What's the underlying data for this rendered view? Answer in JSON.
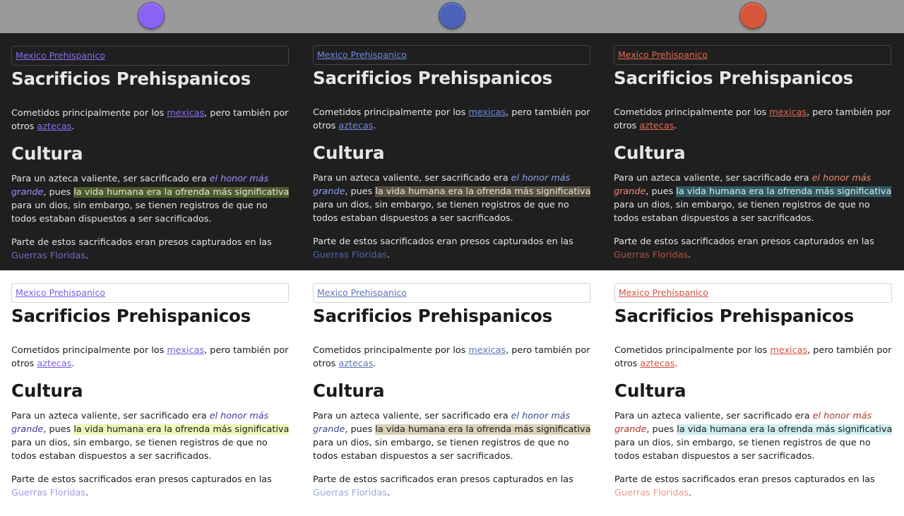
{
  "theme_buttons": [
    {
      "name": "purple-theme-button",
      "color": "#8a63f2"
    },
    {
      "name": "blue-theme-button",
      "color": "#4a63b8"
    },
    {
      "name": "red-theme-button",
      "color": "#d5553b"
    }
  ],
  "content": {
    "breadcrumb": "Mexico Prehispanico",
    "title": "Sacrificios Prehispanicos",
    "intro_before": "Cometidos principalmente por los ",
    "intro_link1": "mexicas",
    "intro_middle": ", pero también por otros ",
    "intro_link2": "aztecas",
    "intro_end": ".",
    "section_heading": "Cultura",
    "cultura_before": "Para un azteca valiente, ser sacrificado era ",
    "cultura_em": "el honor más grande",
    "cultura_after_em": ", pues ",
    "cultura_highlight": "la vida humana era la ofrenda más significativa",
    "cultura_end": " para un dios, sin embargo, se tienen registros de que no todos estaban dispuestos a ser sacrificados.",
    "parte_before": "Parte de estos sacrificados eran presos capturados en las ",
    "parte_link": "Guerras Floridas",
    "parte_end": "."
  },
  "themes": {
    "dark_purple": {
      "link": "#8f6cf5",
      "highlight_bg": "#4e5b2a",
      "faint": "#7a68c0",
      "em": "#a48bff"
    },
    "dark_blue": {
      "link": "#6f8be0",
      "highlight_bg": "#5b513f",
      "faint": "#4f66a8",
      "em": "#8aa2ec"
    },
    "dark_red": {
      "link": "#e46a50",
      "highlight_bg": "#2f5b63",
      "faint": "#b5533f",
      "em": "#ef8a73"
    },
    "light_purple": {
      "link": "#7a5ce0",
      "highlight_bg": "#eef7b8",
      "faint": "#a996e8",
      "em": "#4b36a8"
    },
    "light_blue": {
      "link": "#5f75b8",
      "highlight_bg": "#d9d2b8",
      "faint": "#9aa8d8",
      "em": "#3a4d8a"
    },
    "light_red": {
      "link": "#d0533c",
      "highlight_bg": "#cfeef2",
      "faint": "#e89a86",
      "em": "#b03a24"
    }
  }
}
